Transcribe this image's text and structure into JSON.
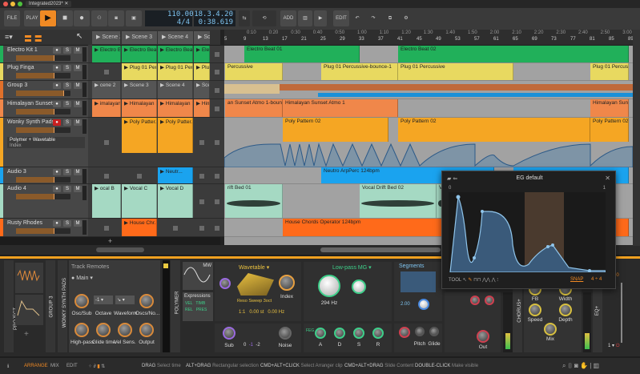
{
  "window": {
    "tab_title": "Integrated2023*"
  },
  "toolbar": {
    "file": "FILE",
    "play_mode": "PLAY",
    "tempo": "110.00",
    "time_signature": "4/4",
    "position_bars": "18.3.4.20",
    "position_time": "0:38.619",
    "add": "ADD",
    "edit": "EDIT",
    "accent": "#f08a24"
  },
  "scenes": [
    "Scene 2",
    "Scene 3",
    "Scene 4",
    "Sce"
  ],
  "ruler": {
    "times": [
      "0:10",
      "0:20",
      "0:30",
      "0:40",
      "0:50",
      "1:00",
      "1:10",
      "1:20",
      "1:30",
      "1:40",
      "1:50",
      "2:00",
      "2:10",
      "2:20",
      "2:30",
      "2:40",
      "2:50",
      "3:00",
      "3:10"
    ],
    "bars": [
      "5",
      "9",
      "13",
      "17",
      "21",
      "25",
      "29",
      "33",
      "37",
      "41",
      "45",
      "49",
      "53",
      "57",
      "61",
      "65",
      "69",
      "73",
      "77",
      "81",
      "85",
      "89"
    ]
  },
  "tracks": [
    {
      "name": "Electro Kit 1",
      "color": "#21b05a",
      "launcher": [
        "Electro Bea...",
        "Electro Bea...",
        "Electro Bea...",
        "Elec"
      ],
      "arranger": [
        {
          "label": "Electro Beat 01",
          "start": 9,
          "end": 33
        },
        {
          "label": "Electro Beat 02",
          "start": 41,
          "end": 89
        }
      ]
    },
    {
      "name": "Plug Finga",
      "color": "#e8d960",
      "launcher": [
        "",
        "Plug 01 Per...",
        "Plug 01 Per...",
        "Plug"
      ],
      "arranger": [
        {
          "label": "Percussive",
          "start": 5,
          "end": 17
        },
        {
          "label": "Plug 01 Percussive-bounce-1",
          "start": 25,
          "end": 41
        },
        {
          "label": "Plug 01 Percussive",
          "start": 41,
          "end": 65
        },
        {
          "label": "Plug 01 Percussive",
          "start": 81,
          "end": 89
        }
      ]
    },
    {
      "name": "Group 3",
      "color": "#e0702a",
      "launcher": [
        "cene 2",
        "Scene 3",
        "Scene 4",
        "Sce"
      ],
      "arranger": []
    },
    {
      "name": "Himalayan Sunset",
      "color": "#f0874a",
      "launcher": [
        "imalayan ...",
        "Himalayan ...",
        "Himalayan ...",
        "Him"
      ],
      "arranger": [
        {
          "label": "an Sunset Atmo 1-bounce-",
          "start": 5,
          "end": 17
        },
        {
          "label": "Himalayan Sunset Atmo 1",
          "start": 17,
          "end": 41
        },
        {
          "label": "Himalayan Sunset At",
          "start": 81,
          "end": 89
        }
      ]
    },
    {
      "name": "Wonky Synth Pads",
      "color": "#f5a623",
      "device": "Polymer + Wavetable",
      "param": "Index",
      "launcher": [
        "",
        "Poly Patter...",
        "Poly Patter...",
        ""
      ],
      "arranger": [
        {
          "label": "Poly Pattern 02",
          "start": 17,
          "end": 39
        },
        {
          "label": "Poly Pattern 02",
          "start": 41,
          "end": 81
        },
        {
          "label": "Poly Pattern 02",
          "start": 81,
          "end": 89
        }
      ]
    },
    {
      "name": "Audio 3",
      "color": "#1aa3ef",
      "launcher": [
        "",
        "",
        "Neutr...",
        ""
      ],
      "arranger": [
        {
          "label": "Neutro ArpPerc 124bpm",
          "start": 25,
          "end": 61
        },
        {
          "label": "",
          "start": 65,
          "end": 89
        }
      ]
    },
    {
      "name": "Audio 4",
      "color": "#a5d9c3",
      "launcher": [
        "ocal B",
        "Vocal C",
        "Vocal D",
        ""
      ],
      "arranger": [
        {
          "label": "rift Bed 01",
          "start": 5,
          "end": 17
        },
        {
          "label": "Vocal Drift Bed 02",
          "start": 33,
          "end": 49
        },
        {
          "label": "Vo",
          "start": 49,
          "end": 51
        }
      ]
    },
    {
      "name": "Rusty Rhodes",
      "color": "#ff6a1a",
      "launcher": [
        "",
        "House Chr...",
        "",
        ""
      ],
      "arranger": [
        {
          "label": "House Chords Operator 124bpm",
          "start": 17,
          "end": 89
        }
      ]
    }
  ],
  "eg_popup": {
    "title": "EG default",
    "min": "0",
    "max": "1",
    "tool": "TOOL",
    "snap": "SNAP",
    "grid": "4",
    "grid2": "4"
  },
  "devices": {
    "project": "PROJECT",
    "group": "GROUP 3",
    "track": "WONKY SYNTH PADS",
    "remotes": {
      "title": "Track Remotes",
      "page": "Main",
      "knobs": [
        "Osc/Sub",
        "Octave",
        "Waveform",
        "Oscs/No...",
        "High-pass",
        "Glide time",
        "Vel Sens.",
        "Output"
      ],
      "octave_value": "-1"
    },
    "polymer": {
      "name": "POLYMER",
      "mw": "MW",
      "expressions": "Expressions",
      "expr": [
        "VEL",
        "TIMB",
        "REL",
        "PRES"
      ],
      "osc": "Wavetable",
      "wavetable": "Reso Sweep 3oct",
      "index": "Index",
      "ratio": "1:1",
      "st": "0.00 st",
      "hz": "0.00 Hz",
      "sub": "Sub",
      "noise": "Noise",
      "sub_vals": [
        "0",
        "-1",
        "-2"
      ],
      "filter": "Low-pass MG",
      "cutoff": "294 Hz",
      "segments": "Segments",
      "seg_value": "2.00",
      "adsr": [
        "A",
        "D",
        "S",
        "R"
      ],
      "pitch": "Pitch",
      "glide": "Glide",
      "out": "Out",
      "feg": "FEG"
    },
    "chorus": {
      "name": "CHORUS+",
      "knobs": [
        "FB",
        "Width",
        "Speed",
        "Depth",
        "Mix"
      ]
    },
    "eq": "EQ+",
    "mixer_value": "0.00",
    "channel": "1"
  },
  "statusbar": {
    "tabs": [
      "ARRANGE",
      "MIX",
      "EDIT"
    ],
    "hints": [
      [
        "DRAG",
        "Select time"
      ],
      [
        "ALT+DRAG",
        "Rectangular selection"
      ],
      [
        "CMD+ALT+CLICK",
        "Select Arranger clip"
      ],
      [
        "CMD+ALT+DRAG",
        "Slide Content"
      ],
      [
        "DOUBLE-CLICK",
        "Make visible"
      ]
    ]
  }
}
